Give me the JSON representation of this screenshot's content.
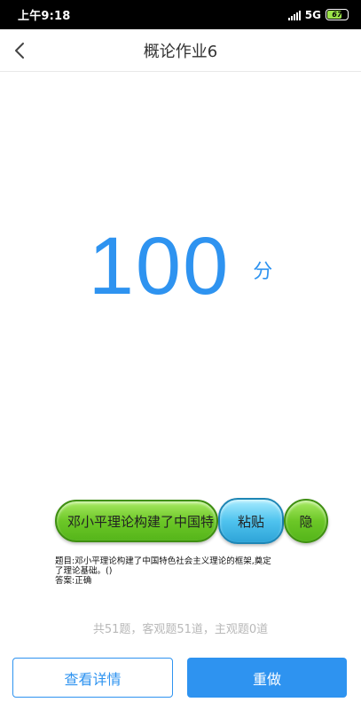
{
  "status_bar": {
    "time": "上午9:18",
    "network": "5G",
    "battery_level": "67"
  },
  "header": {
    "back_icon": "chevron-left-icon",
    "title": "概论作业6"
  },
  "score": {
    "value": "100",
    "unit": "分",
    "color": "#2e93f0"
  },
  "helper": {
    "answer_text": "邓小平理论构建了中国特",
    "paste_label": "粘贴",
    "hide_label": "隐",
    "question_line1": "题目:邓小平理论构建了中国特色社会主义理论的框架,奠定",
    "question_line2": "了理论基础。()",
    "answer_line": "答案:正确"
  },
  "summary": "共51题，客观题51道，主观题0道",
  "buttons": {
    "details_label": "查看详情",
    "redo_label": "重做"
  },
  "colors": {
    "accent": "#2e93f0",
    "green_pill": "#6cc727",
    "blue_pill": "#4fc3ee"
  }
}
